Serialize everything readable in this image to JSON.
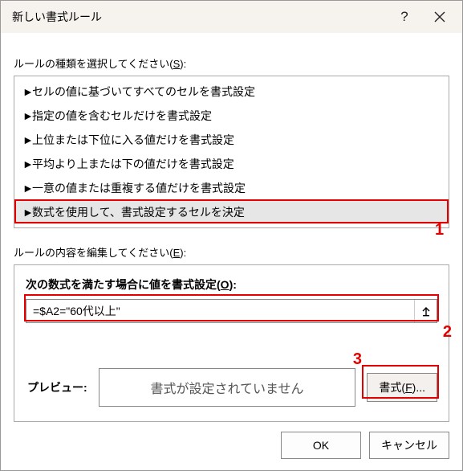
{
  "titlebar": {
    "title": "新しい書式ルール",
    "help": "?",
    "close": "✕"
  },
  "labels": {
    "select_rule_type_pre": "ルールの種類を選択してください(",
    "select_rule_type_key": "S",
    "select_rule_type_post": "):",
    "edit_rule_desc_pre": "ルールの内容を編集してください(",
    "edit_rule_desc_key": "E",
    "edit_rule_desc_post": "):",
    "formula_label_pre": "次の数式を満たす場合に値を書式設定(",
    "formula_label_key": "O",
    "formula_label_post": "):",
    "preview": "プレビュー:",
    "no_format": "書式が設定されていません",
    "format_btn_pre": "書式(",
    "format_btn_key": "F",
    "format_btn_post": ")...",
    "ok": "OK",
    "cancel": "キャンセル"
  },
  "rule_types": [
    "セルの値に基づいてすべてのセルを書式設定",
    "指定の値を含むセルだけを書式設定",
    "上位または下位に入る値だけを書式設定",
    "平均より上または下の値だけを書式設定",
    "一意の値または重複する値だけを書式設定",
    "数式を使用して、書式設定するセルを決定"
  ],
  "formula_value": "=$A2=\"60代以上\"",
  "annotations": {
    "a1": "1",
    "a2": "2",
    "a3": "3"
  }
}
